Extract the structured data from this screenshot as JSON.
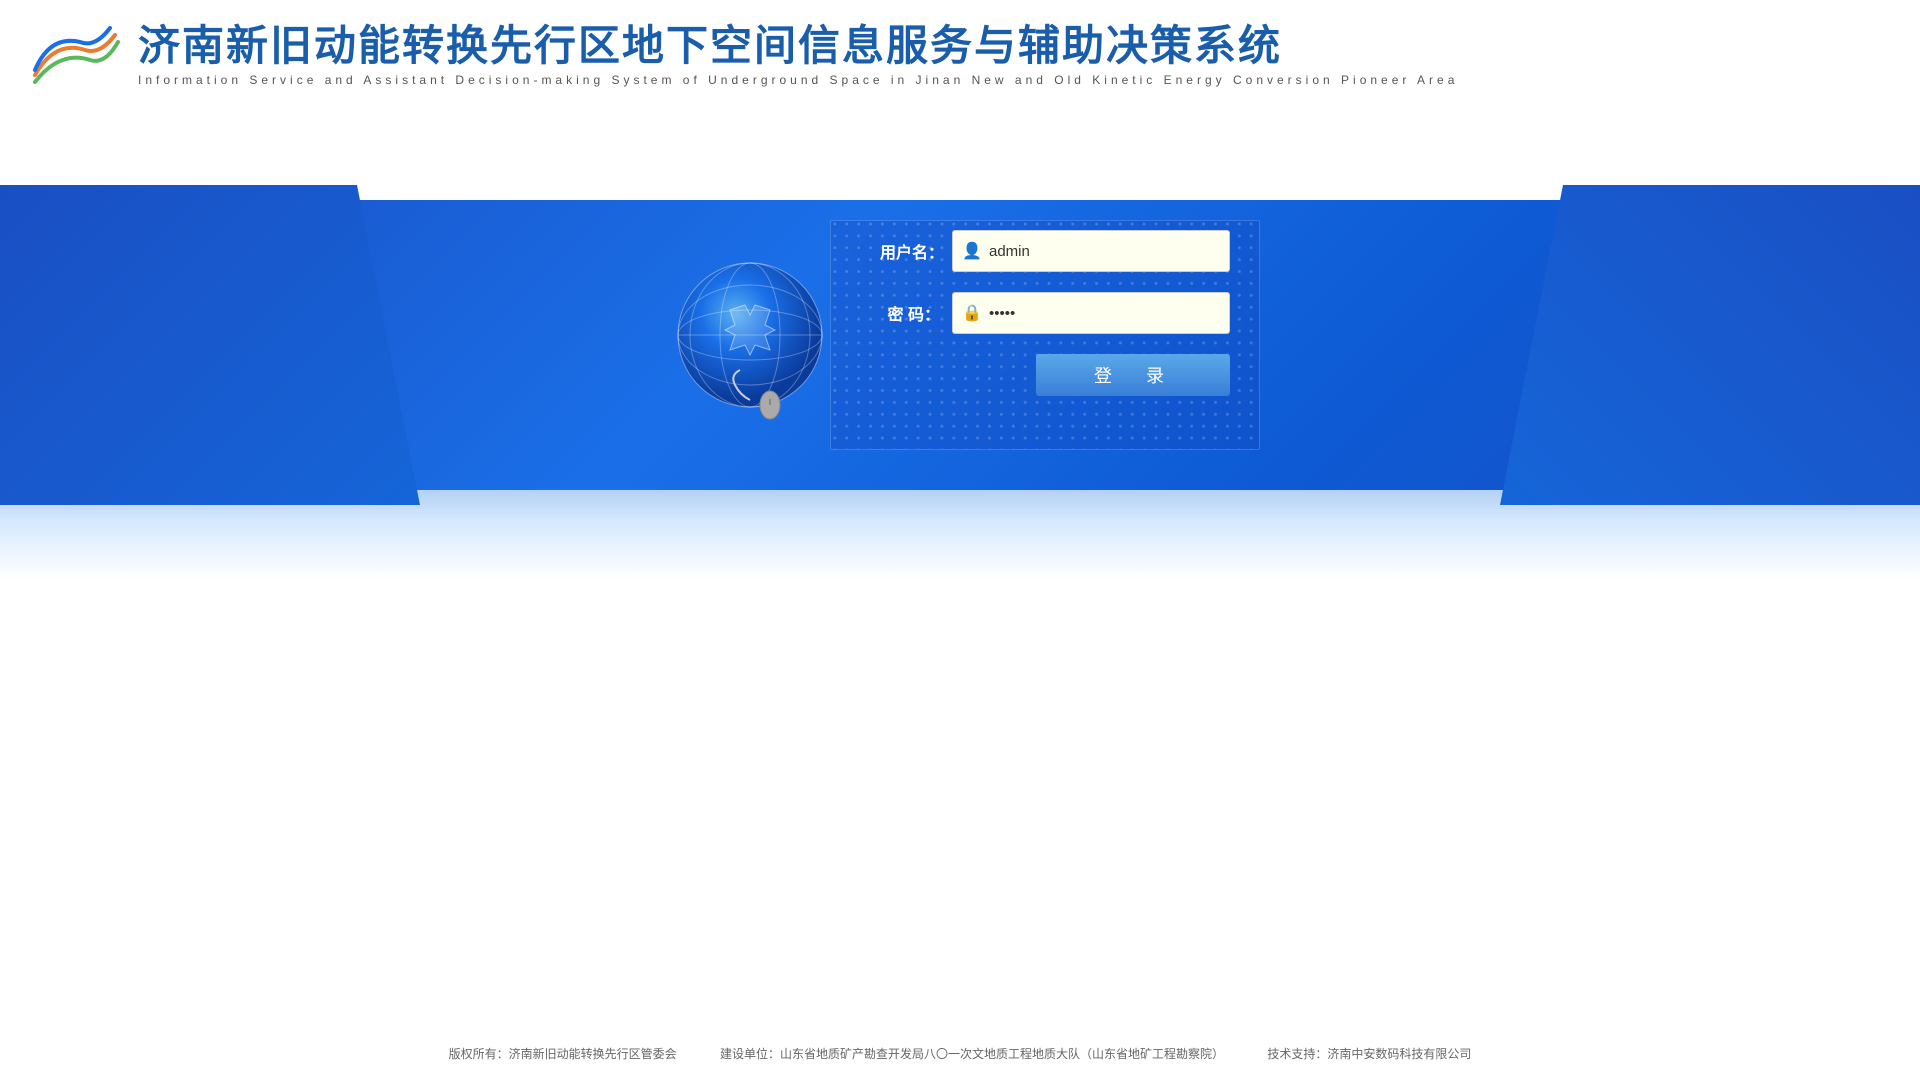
{
  "header": {
    "main_title": "济南新旧动能转换先行区地下空间信息服务与辅助决策系统",
    "sub_title": "Information  Service  and  Assistant  Decision-making  System  of  Underground  Space  in  Jinan  New  and  Old  Kinetic  Energy  Conversion  Pioneer  Area"
  },
  "form": {
    "username_label": "用户名：",
    "password_label": "密  码：",
    "username_value": "admin",
    "password_value": "•••••",
    "login_button_label": "登　录"
  },
  "footer": {
    "copyright": "版权所有：济南新旧动能转换先行区管委会",
    "builder": "建设单位：山东省地质矿产勘查开发局八〇一次文地质工程地质大队（山东省地矿工程勘察院）",
    "tech_support": "技术支持：济南中安数码科技有限公司"
  }
}
